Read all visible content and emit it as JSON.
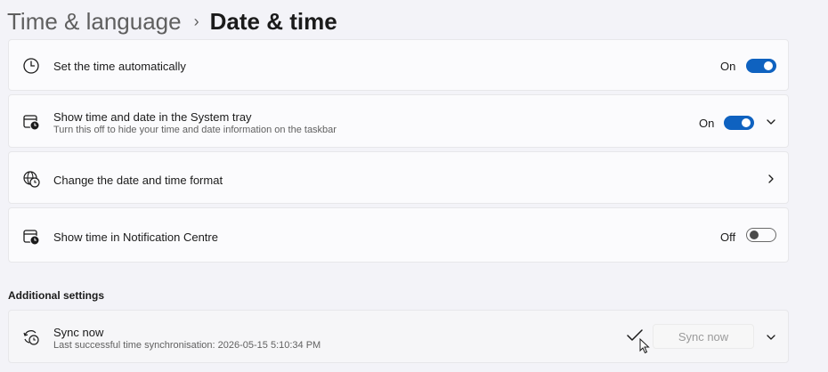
{
  "breadcrumb": {
    "parent": "Time & language",
    "separator": "›",
    "current": "Date & time"
  },
  "settings": [
    {
      "title": "Set the time automatically",
      "state": "On",
      "icon": "clock-icon"
    },
    {
      "title": "Show time and date in the System tray",
      "subtitle": "Turn this off to hide your time and date information on the taskbar",
      "state": "On",
      "icon": "calendar-clock-icon"
    },
    {
      "title": "Change the date and time format",
      "icon": "globe-clock-icon"
    },
    {
      "title": "Show time in Notification Centre",
      "state": "Off",
      "icon": "calendar-clock-icon"
    }
  ],
  "additional": {
    "heading": "Additional settings",
    "sync": {
      "title": "Sync now",
      "subtitle": "Last successful time synchronisation: 2026-05-15 5:10:34 PM",
      "button_label": "Sync now",
      "icon": "sync-clock-icon"
    }
  },
  "colors": {
    "accent": "#0f62c0",
    "background": "#f3f3f8",
    "card": "#fbfbfd"
  }
}
